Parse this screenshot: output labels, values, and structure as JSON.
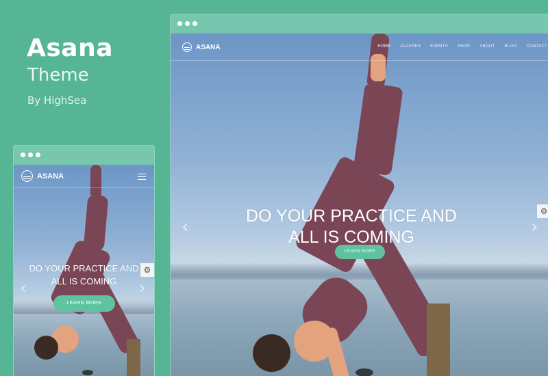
{
  "promo": {
    "title": "Asana",
    "subtitle": "Theme",
    "byline": "By HighSea"
  },
  "desktop": {
    "logo_text": "ASANA",
    "nav": [
      "HOME",
      "CLASSES",
      "EVENTS",
      "SHOP",
      "ABOUT",
      "BLOG",
      "CONTACT"
    ],
    "active_nav": "HOME",
    "hero_line1": "DO YOUR PRACTICE AND",
    "hero_line2": "ALL IS COMING",
    "cta_label": "LEARN MORE",
    "prev_arrow": "‹",
    "next_arrow": "›",
    "gear_icon": "⚙"
  },
  "mobile": {
    "logo_text": "ASANA",
    "hero_line1": "DO YOUR PRACTICE AND",
    "hero_line2": "ALL IS COMING",
    "cta_label": "LEARN MORE",
    "prev_arrow": "‹",
    "next_arrow": "›",
    "gear_icon": "⚙"
  },
  "colors": {
    "background": "#55b594",
    "window_bar": "#76c7ae",
    "cta": "#5fc3a0",
    "outfit": "#7a4656"
  }
}
